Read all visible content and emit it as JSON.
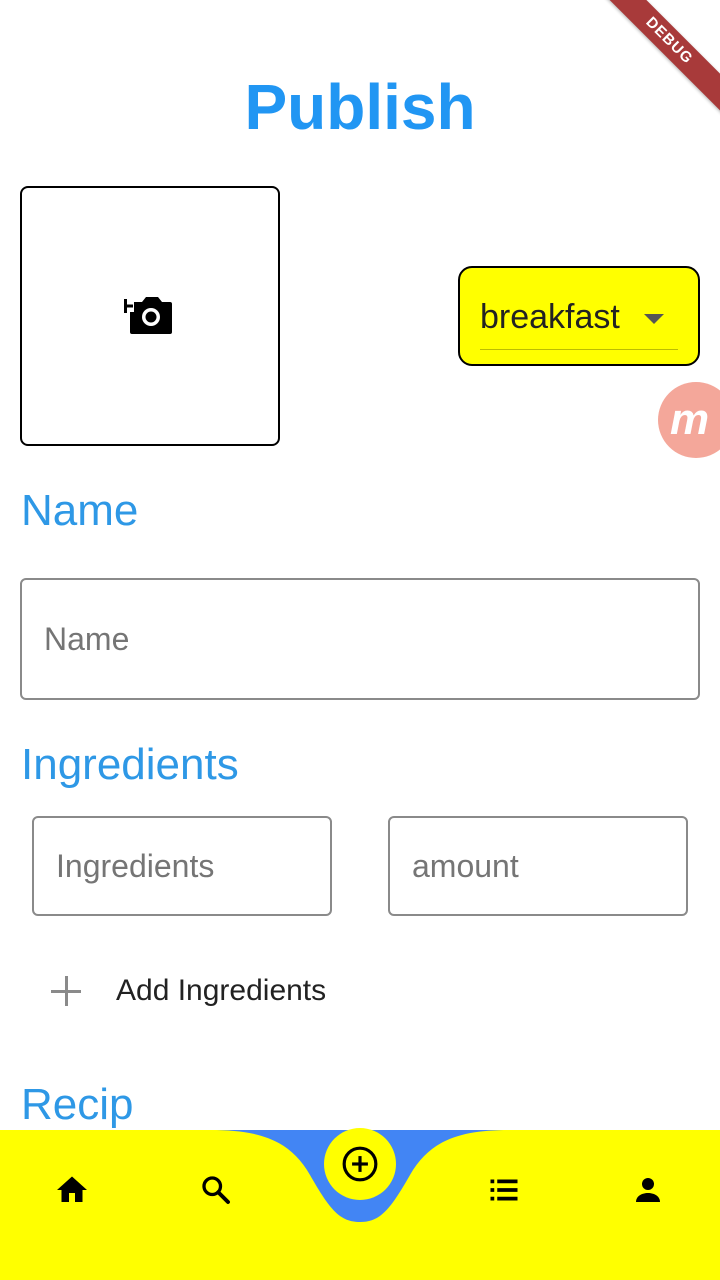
{
  "debug_banner": "DEBUG",
  "header": {
    "title": "Publish"
  },
  "photo": {
    "icon": "add-a-photo-icon"
  },
  "category": {
    "value": "breakfast"
  },
  "badge": {
    "text": "m"
  },
  "name_section": {
    "label": "Name",
    "placeholder": "Name",
    "value": ""
  },
  "ingredients_section": {
    "label": "Ingredients",
    "ingredient_placeholder": "Ingredients",
    "amount_placeholder": "amount",
    "add_label": "Add Ingredients"
  },
  "recipe_section": {
    "label": "Recip"
  },
  "bottom_nav": {
    "items": [
      {
        "icon": "home-icon"
      },
      {
        "icon": "search-icon"
      },
      {
        "icon": "add-circle-icon"
      },
      {
        "icon": "list-icon"
      },
      {
        "icon": "person-icon"
      }
    ]
  },
  "colors": {
    "accent": "#2196f3",
    "nav_background": "#ffff00",
    "nav_curve": "#4285f4",
    "debug": "#a83a3a"
  }
}
